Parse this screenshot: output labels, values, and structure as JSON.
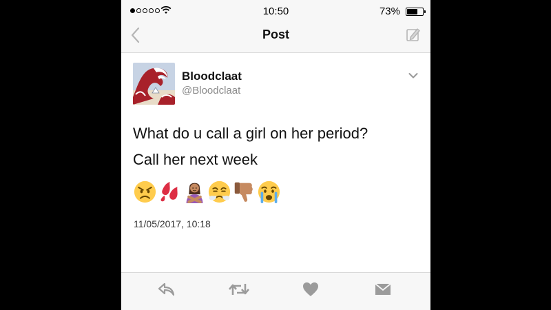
{
  "status_bar": {
    "time": "10:50",
    "battery_percent": "73%",
    "battery_level": 0.73,
    "signal_bars_filled": 1,
    "signal_bars_total": 5
  },
  "nav": {
    "title": "Post",
    "back_icon": "chevron-left-icon",
    "compose_icon": "compose-icon"
  },
  "tweet": {
    "display_name": "Bloodclaat",
    "handle": "@Bloodclaat",
    "text_lines": [
      "What do u call a girl on her period?",
      "Call her next week"
    ],
    "emojis": [
      "angry-face-icon",
      "blood-drops-icon",
      "woman-gesturing-no-icon",
      "face-with-steam-icon",
      "thumbs-down-icon",
      "crying-face-icon"
    ],
    "timestamp": "11/05/2017, 10:18"
  },
  "actions": [
    {
      "name": "reply-icon"
    },
    {
      "name": "retweet-icon"
    },
    {
      "name": "like-icon"
    },
    {
      "name": "direct-message-icon"
    }
  ],
  "colors": {
    "background": "#000000",
    "bar_background": "#f7f7f7",
    "card_background": "#ffffff",
    "handle_gray": "#8a8a8a",
    "icon_gray": "#9b9b9b"
  }
}
